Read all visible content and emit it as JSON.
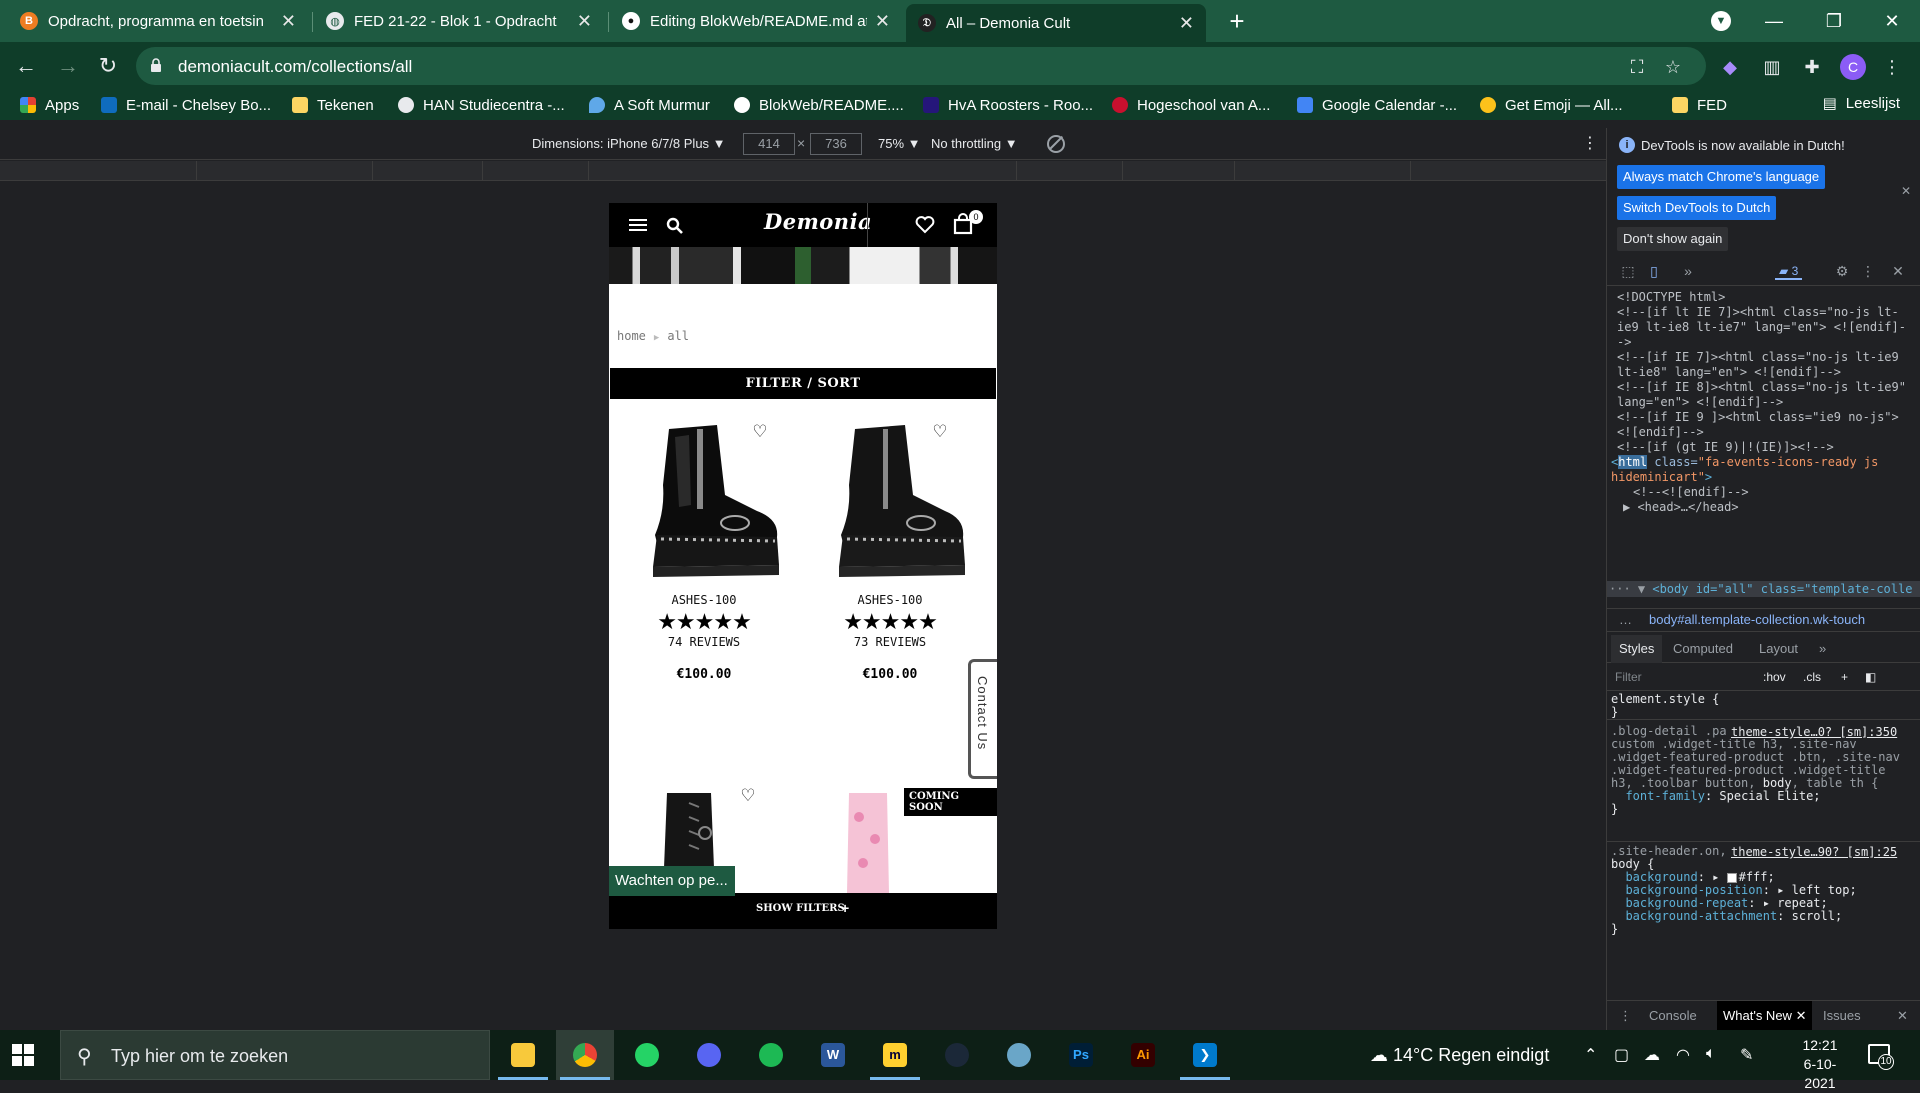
{
  "browser": {
    "tabs": [
      {
        "title": "Opdracht, programma en toetsin",
        "favicon": "b-orange-icon",
        "color": "#ee7d22"
      },
      {
        "title": "FED 21-22 - Blok 1 - Opdracht",
        "favicon": "globe-icon",
        "color": "#e8eaed"
      },
      {
        "title": "Editing BlokWeb/README.md at",
        "favicon": "github-icon",
        "color": "#ffffff"
      },
      {
        "title": "All – Demonia Cult",
        "favicon": "demonia-icon",
        "color": "#222222"
      }
    ],
    "url": "demoniacult.com/collections/all",
    "profile_initial": "C",
    "bookmarks": [
      {
        "label": "Apps",
        "icon": "apps-grid-icon",
        "color": "#e34133"
      },
      {
        "label": "E-mail - Chelsey Bo...",
        "icon": "outlook-icon",
        "color": "#0f6cbd"
      },
      {
        "label": "Tekenen",
        "icon": "folder-yellow-icon",
        "color": "#fdd663"
      },
      {
        "label": "HAN Studiecentra -...",
        "icon": "globe-icon",
        "color": "#e8eaed"
      },
      {
        "label": "A Soft Murmur",
        "icon": "drop-icon",
        "color": "#5fa8e8"
      },
      {
        "label": "BlokWeb/README....",
        "icon": "github-icon",
        "color": "#ffffff"
      },
      {
        "label": "HvA Roosters - Roo...",
        "icon": "hva-icon",
        "color": "#25167a"
      },
      {
        "label": "Hogeschool van A...",
        "icon": "go-icon",
        "color": "#c8102e"
      },
      {
        "label": "Google Calendar -...",
        "icon": "calendar-icon",
        "color": "#4285f4"
      },
      {
        "label": "Get Emoji — All...",
        "icon": "emoji-icon",
        "color": "#fcc21b"
      },
      {
        "label": "FED",
        "icon": "folder-yellow-icon",
        "color": "#fdd663"
      }
    ],
    "reading_list": "Leeslijst"
  },
  "device_toolbar": {
    "dimensions_label": "Dimensions: iPhone 6/7/8 Plus ▼",
    "width": "414",
    "height": "736",
    "zoom": "75% ▼",
    "throttling": "No throttling ▼"
  },
  "page": {
    "logo": "Demonia",
    "cart_count": "0",
    "breadcrumb": {
      "home": "home",
      "current": "all"
    },
    "filter_sort": "FILTER / SORT",
    "products": [
      {
        "name": "ASHES-100",
        "stars": "★★★★★",
        "reviews": "74 REVIEWS",
        "price": "€100.00"
      },
      {
        "name": "ASHES-100",
        "stars": "★★★★★",
        "reviews": "73 REVIEWS",
        "price": "€100.00"
      }
    ],
    "coming_soon": "COMING SOON",
    "contact_us": "Contact Us",
    "show_filters": "SHOW FILTERS",
    "status_waiting": "Wachten op pe..."
  },
  "devtools": {
    "notice": "DevTools is now available in Dutch!",
    "btn_match": "Always match Chrome's language",
    "btn_switch": "Switch DevTools to Dutch",
    "btn_dont_show": "Don't show again",
    "message_count": "3",
    "dom_lines": [
      "<!DOCTYPE html>",
      "<!--[if lt IE 7]><html class=\"no-js lt-ie9 lt-ie8 lt-ie7\" lang=\"en\"> <![endif]-->",
      "<!--[if IE 7]><html class=\"no-js lt-ie9 lt-ie8\" lang=\"en\"> <![endif]-->",
      "<!--[if IE 8]><html class=\"no-js lt-ie9\" lang=\"en\"> <![endif]-->",
      "<!--[if IE 9 ]><html class=\"ie9 no-js\"> <![endif]-->",
      "<!--[if (gt IE 9)|!(IE)]><!-->"
    ],
    "html_tag": "html",
    "html_class_attr": "class=",
    "html_class_val": "\"fa-events-icons-ready js hideminicart\"",
    "endif_comment": "<!--<![endif]-->",
    "head_line": "<head>…</head>",
    "body_line": "<body id=\"all\" class=\"template-colle",
    "breadcrumb_path": "body#all.template-collection.wk-touch",
    "styles_tabs": [
      "Styles",
      "Computed",
      "Layout"
    ],
    "filter_placeholder": "Filter",
    "hov": ":hov",
    "cls": ".cls",
    "element_style": "element.style {",
    "rule1_selector": ".blog-detail .page-header h1, .sidebar-custom .widget-title h3, .site-nav .widget-featured-product .btn, .site-nav .widget-featured-product .widget-title h3, .toolbar button,",
    "rule1_selector_b": "body",
    "rule1_selector_c": ", table th {",
    "rule1_link": "theme-style…0? [sm]:350",
    "rule1_prop": "font-family",
    "rule1_val": "Special Elite;",
    "rule2_selector": ".site-header.on,",
    "rule2_selector_b": "body {",
    "rule2_link": "theme-style…90? [sm]:25",
    "rule2_props": [
      {
        "prop": "background",
        "val": "#fff;"
      },
      {
        "prop": "background-position",
        "val": "left top;"
      },
      {
        "prop": "background-repeat",
        "val": "repeat;"
      },
      {
        "prop": "background-attachment",
        "val": "scroll;"
      }
    ],
    "drawer_tabs": [
      "Console",
      "What's New",
      "Issues"
    ]
  },
  "taskbar": {
    "search_placeholder": "Typ hier om te zoeken",
    "weather": "14°C  Regen eindigt",
    "time": "12:21",
    "date": "6-10-2021",
    "notification_count": "10",
    "apps": [
      {
        "name": "file-explorer-icon",
        "color": "#f8c93b"
      },
      {
        "name": "chrome-icon",
        "color": "#4285f4"
      },
      {
        "name": "whatsapp-icon",
        "color": "#25d366"
      },
      {
        "name": "discord-icon",
        "color": "#5865f2"
      },
      {
        "name": "spotify-icon",
        "color": "#1db954"
      },
      {
        "name": "word-icon",
        "color": "#2b579a"
      },
      {
        "name": "miro-icon",
        "color": "#ffd02f"
      },
      {
        "name": "steam-icon",
        "color": "#1b2838"
      },
      {
        "name": "paint-icon",
        "color": "#6aa6c8"
      },
      {
        "name": "photoshop-icon",
        "color": "#001e36"
      },
      {
        "name": "illustrator-icon",
        "color": "#330000"
      },
      {
        "name": "vscode-icon",
        "color": "#007acc"
      }
    ]
  }
}
